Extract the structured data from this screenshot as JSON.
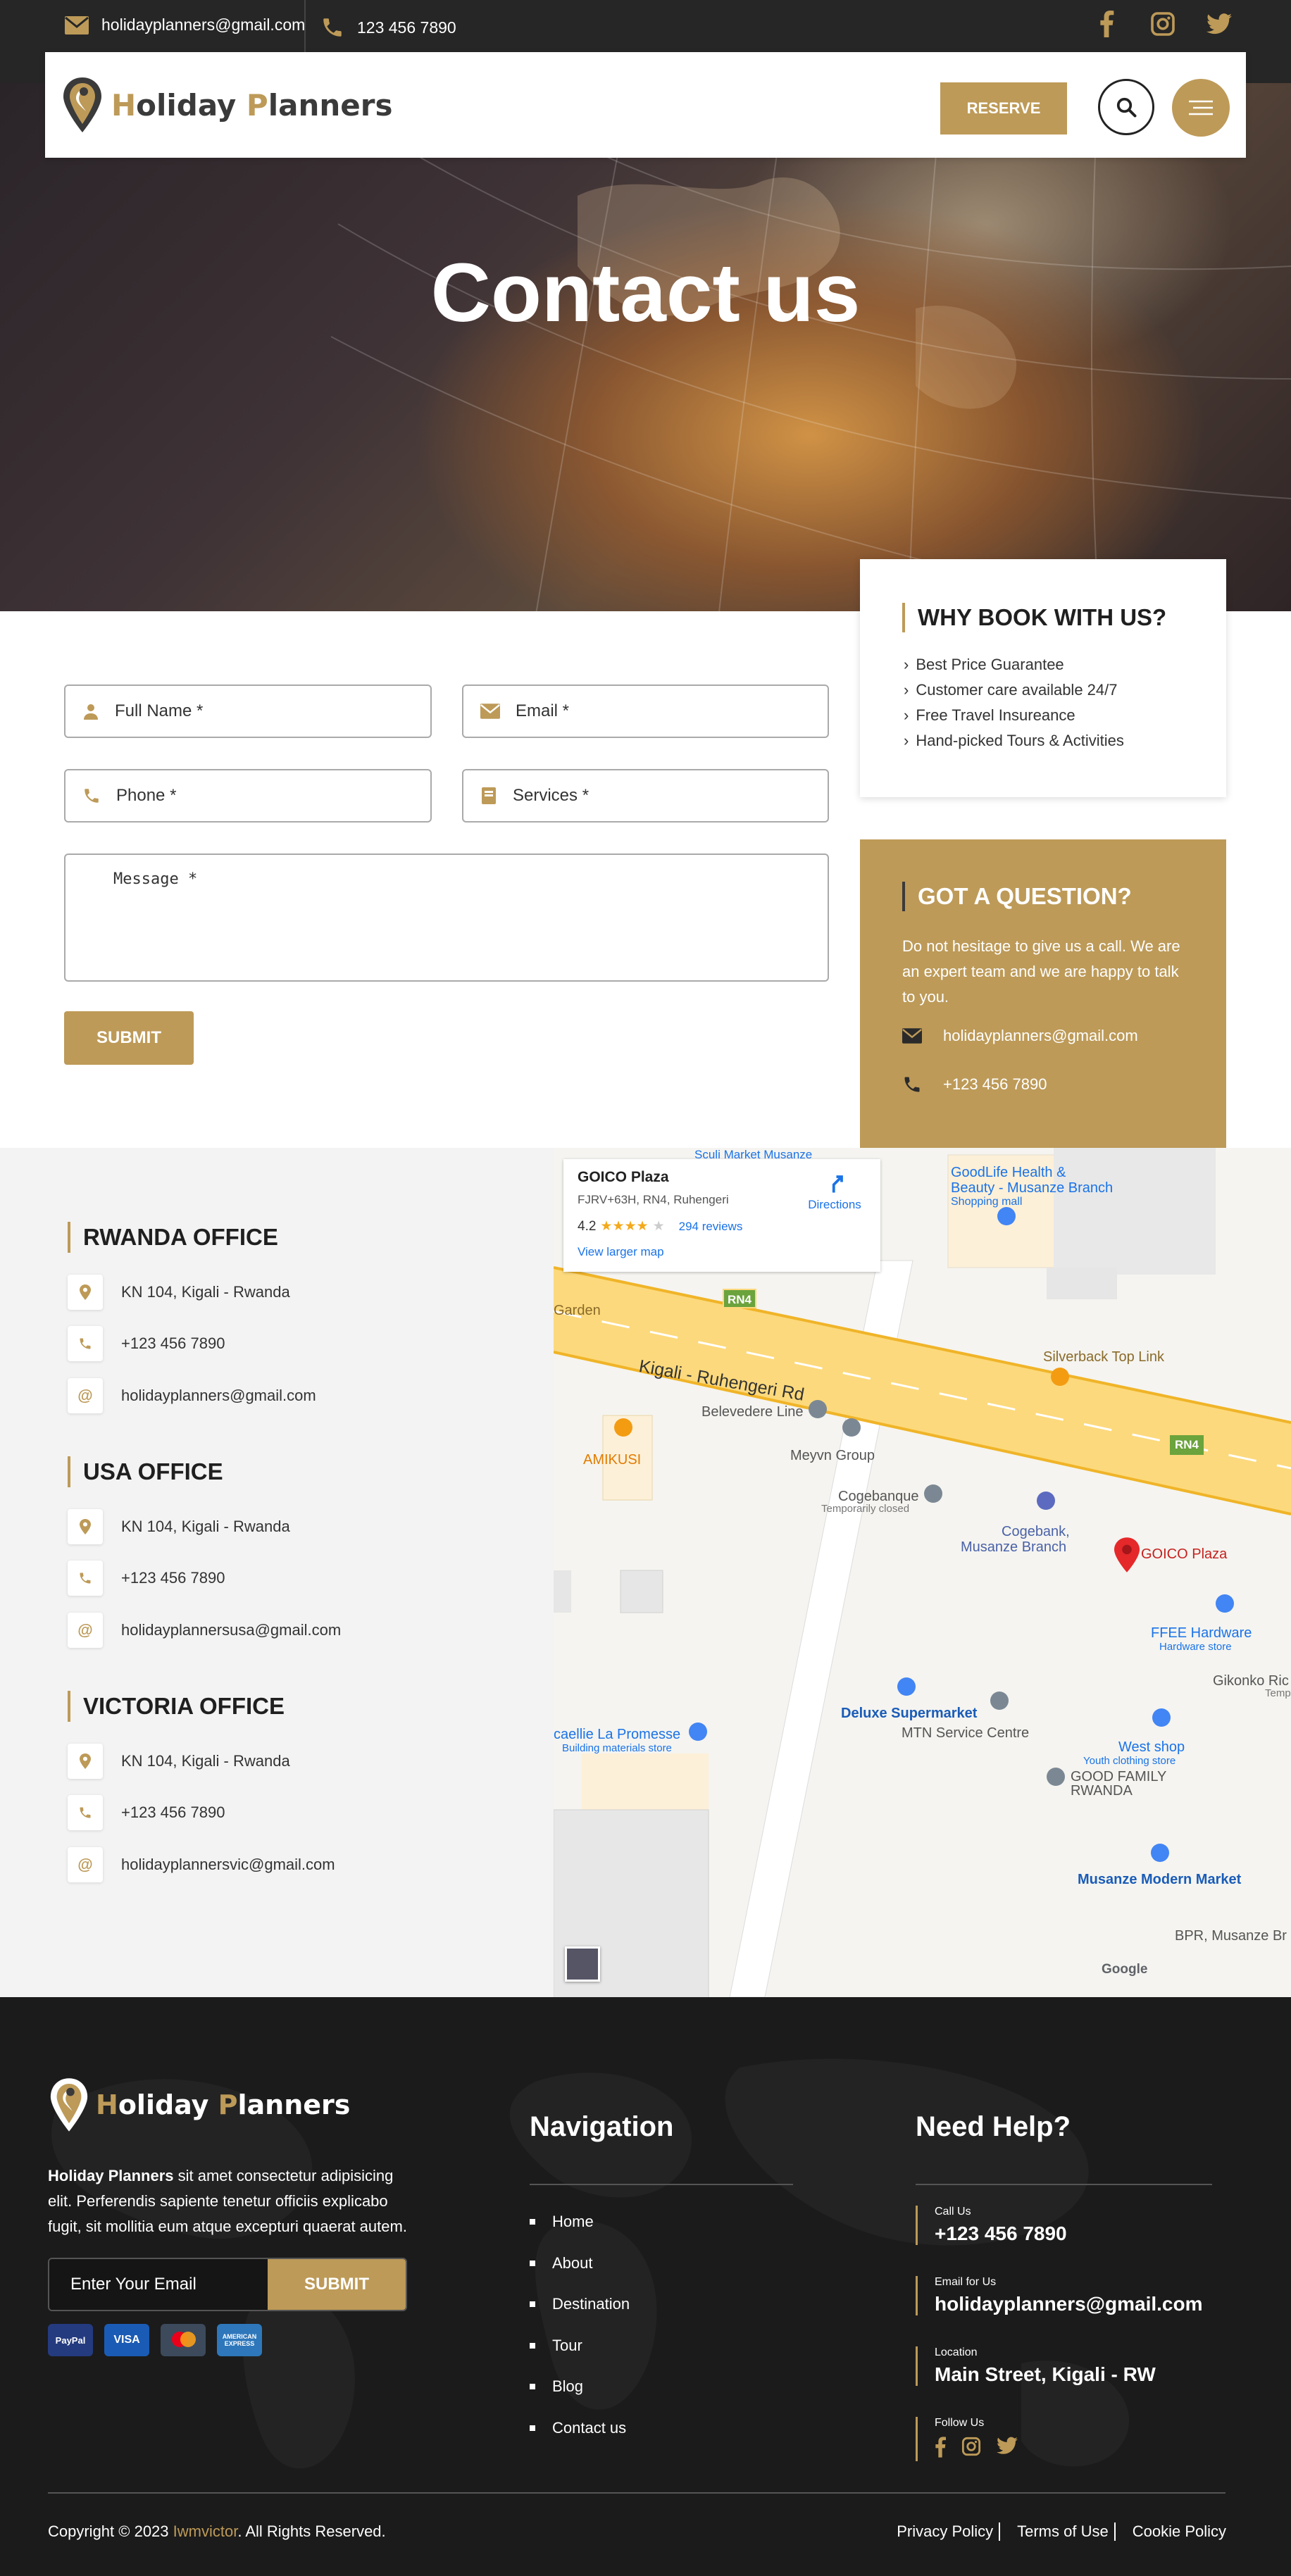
{
  "topbar": {
    "email": "holidayplanners@gmail.com",
    "phone": "123 456 7890",
    "social_icons": [
      "facebook-icon",
      "instagram-icon",
      "twitter-icon"
    ]
  },
  "header": {
    "logo_first": "H",
    "logo_rest": "oliday ",
    "logo_second": "P",
    "logo_second_rest": "lanners",
    "reserve_label": "RESERVE"
  },
  "hero": {
    "title": "Contact us"
  },
  "form": {
    "full_name_placeholder": "Full Name *",
    "email_placeholder": "Email *",
    "phone_placeholder": "Phone *",
    "services_placeholder": "Services *",
    "message_placeholder": "Message *",
    "submit_label": "SUBMIT"
  },
  "why_card": {
    "title": "WHY BOOK WITH US?",
    "items": [
      "Best Price Guarantee",
      "Customer care available 24/7",
      "Free Travel Insureance",
      "Hand-picked Tours & Activities"
    ]
  },
  "question_card": {
    "title": "GOT A QUESTION?",
    "text": "Do not hesitage to give us a call. We are an expert team and we are happy to talk to you.",
    "email": "holidayplanners@gmail.com",
    "phone": "+123 456 7890"
  },
  "offices": [
    {
      "title": "RWANDA OFFICE",
      "address": "KN 104, Kigali - Rwanda",
      "phone": "+123 456 7890",
      "email": "holidayplanners@gmail.com"
    },
    {
      "title": "USA OFFICE",
      "address": "KN 104, Kigali - Rwanda",
      "phone": "+123 456 7890",
      "email": "holidayplannersusa@gmail.com"
    },
    {
      "title": "VICTORIA OFFICE",
      "address": "KN 104, Kigali - Rwanda",
      "phone": "+123 456 7890",
      "email": "holidayplannersvic@gmail.com"
    }
  ],
  "map": {
    "place_name": "GOICO Plaza",
    "place_address": "FJRV+63H, RN4, Ruhengeri",
    "rating": "4.2",
    "stars": "★★★★",
    "star_empty": "★",
    "reviews": "294 reviews",
    "directions": "Directions",
    "larger_map": "View larger map",
    "road": "Kigali - Ruhengeri Rd",
    "route_badge": "RN4",
    "labels": {
      "top_cut": "Sculi Market Musanze",
      "goodlife_1": "GoodLife Health &",
      "goodlife_2": "Beauty - Musanze Branch",
      "goodlife_3": "Shopping mall",
      "garden": "Garden",
      "silverback": "Silverback Top Link",
      "belevedere": "Belevedere Line",
      "amakusi": "AMIKUSI",
      "meyvn": "Meyvn Group",
      "cogebanque": "Cogebanque",
      "temp_closed": "Temporarily closed",
      "cogebank_1": "Cogebank,",
      "cogebank_2": "Musanze Branch",
      "goico_pin": "GOICO Plaza",
      "ffee_1": "FFEE Hardware",
      "ffee_2": "Hardware store",
      "gikonko": "Gikonko Ric",
      "temp_cut": "Temp",
      "deluxe": "Deluxe Supermarket",
      "mtn": "MTN Service Centre",
      "west_1": "West shop",
      "west_2": "Youth clothing store",
      "good_1": "GOOD FAMILY",
      "good_2": "RWANDA",
      "promesse_1": "caellie La Promesse",
      "promesse_2": "Building materials store",
      "modern": "Musanze Modern Market",
      "bpr": "BPR, Musanze Br",
      "google": "Google"
    }
  },
  "footer": {
    "about_brand": "Holiday Planners",
    "about_text": " sit amet consectetur adipisicing elit. Perferendis sapiente tenetur officiis explicabo fugit, sit mollitia eum atque excepturi quaerat autem.",
    "newsletter_placeholder": "Enter Your Email",
    "newsletter_button": "SUBMIT",
    "payments": [
      "PayPal",
      "VISA",
      "mastercard",
      "AMERICAN EXPRESS"
    ],
    "nav_title": "Navigation",
    "nav_items": [
      "Home",
      "About",
      "Destination",
      "Tour",
      "Blog",
      "Contact us"
    ],
    "help_title": "Need Help?",
    "help": {
      "call_label": "Call Us",
      "call_value": "+123 456 7890",
      "email_label": "Email for Us",
      "email_value": "holidayplanners@gmail.com",
      "location_label": "Location",
      "location_value": "Main Street, Kigali - RW",
      "follow_label": "Follow Us"
    },
    "copyright_pre": "Copyright © 2023 ",
    "copyright_name": "Iwmvictor",
    "copyright_post": ". All Rights Reserved.",
    "legal": [
      "Privacy Policy",
      "Terms of Use",
      "Cookie Policy"
    ]
  },
  "colors": {
    "gold": "#bd9a58",
    "dark": "#262626",
    "footer": "#1b1b1b"
  }
}
